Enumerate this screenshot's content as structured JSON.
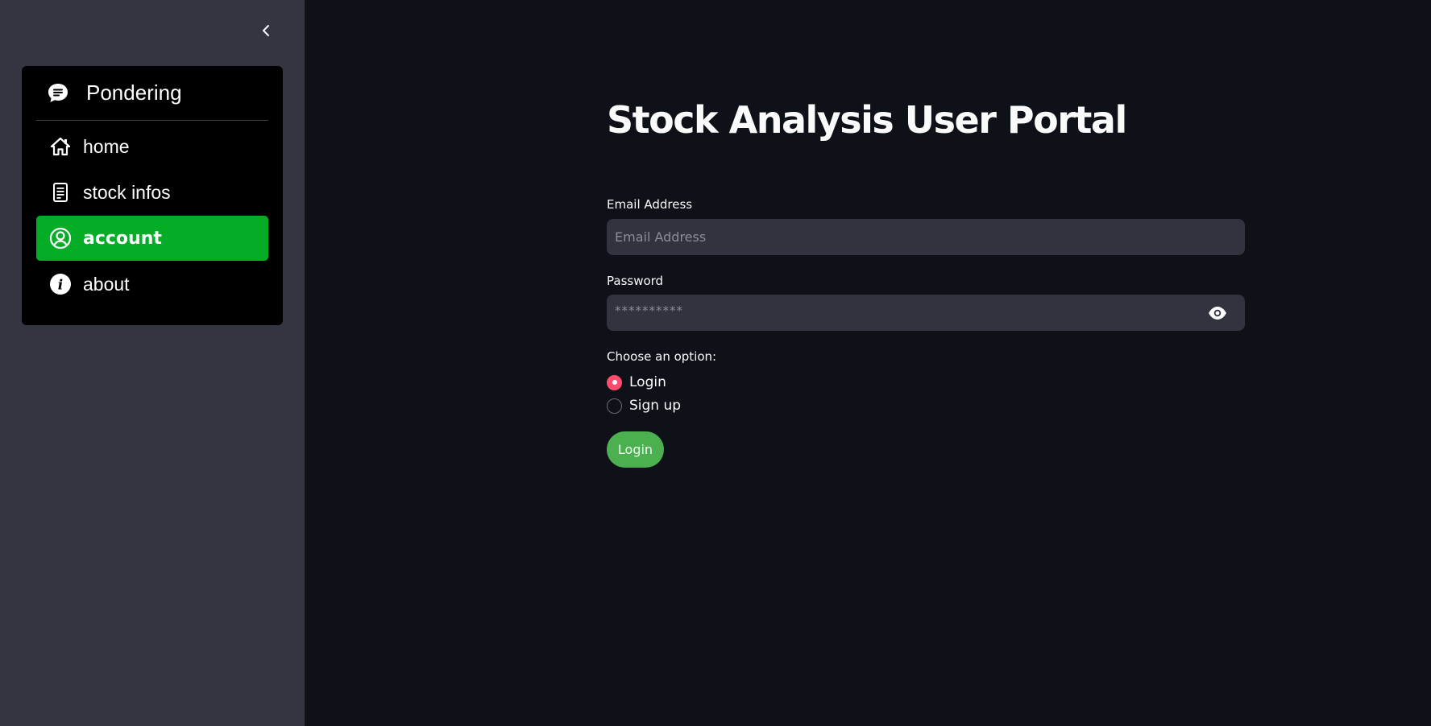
{
  "sidebar": {
    "collapse_icon": "chevron-left-icon",
    "menu": {
      "title": "Pondering",
      "title_icon": "chat-bubble-icon",
      "items": [
        {
          "label": "home",
          "icon": "house-icon",
          "active": false
        },
        {
          "label": "stock infos",
          "icon": "document-icon",
          "active": false
        },
        {
          "label": "account",
          "icon": "person-circle-icon",
          "active": true
        },
        {
          "label": "about",
          "icon": "info-circle-icon",
          "active": false
        }
      ],
      "active_color": "#05ad26"
    }
  },
  "main": {
    "title": "Stock Analysis User Portal",
    "email": {
      "label": "Email Address",
      "placeholder": "Email Address",
      "value": ""
    },
    "password": {
      "label": "Password",
      "masked_value": "**********",
      "toggle_icon": "eye-icon"
    },
    "option": {
      "label": "Choose an option:",
      "choices": [
        "Login",
        "Sign up"
      ],
      "selected": "Login"
    },
    "submit_label": "Login",
    "colors": {
      "background": "#0e1117",
      "sidebar": "#333541",
      "radio_accent": "#ff4b6e",
      "button": "#4caf50"
    }
  }
}
